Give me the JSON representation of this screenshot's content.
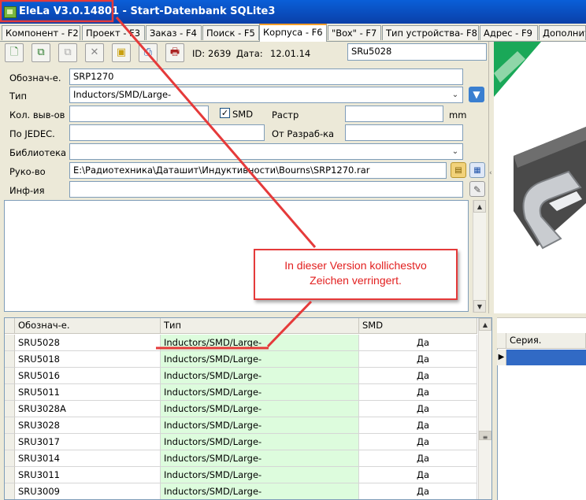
{
  "window": {
    "app_name": "EleLa V3.0.14801",
    "title_rest": " - Start-Datenbank SQLite3"
  },
  "tabs": [
    {
      "label": "Компонент - F2"
    },
    {
      "label": "Проект - F3"
    },
    {
      "label": "Заказ - F4"
    },
    {
      "label": "Поиск - F5"
    },
    {
      "label": "Корпуса - F6",
      "active": true
    },
    {
      "label": "\"Box\" - F7"
    },
    {
      "label": "Тип устройства- F8"
    },
    {
      "label": "Адрес - F9"
    },
    {
      "label": "Дополнит"
    }
  ],
  "toolbar": {
    "buttons": [
      {
        "name": "new-record-icon",
        "glyph": "🗋"
      },
      {
        "name": "copy-record-icon",
        "glyph": "⧉"
      },
      {
        "name": "copy-disabled-icon",
        "glyph": "⧉"
      },
      {
        "name": "delete-icon",
        "glyph": "✕"
      },
      {
        "name": "save-icon",
        "glyph": "▣"
      },
      {
        "name": "print-icon",
        "glyph": "⎙"
      },
      {
        "name": "print-preview-icon",
        "glyph": "🖶"
      }
    ],
    "id_label": "ID:",
    "id_value": "2639",
    "date_label": "Дата:",
    "date_value": "12.01.14",
    "name_value": "SRu5028"
  },
  "form": {
    "designation_label": "Обознач-е.",
    "designation_value": "SRP1270",
    "type_label": "Тип",
    "type_value": "Inductors/SMD/Large-",
    "pins_label": "Кол. выв-ов",
    "pins_value": "",
    "smd_label": "SMD",
    "smd_checked": true,
    "pitch_label": "Растр",
    "pitch_value": "",
    "pitch_unit": "mm",
    "jedec_label": "По JEDEC.",
    "jedec_value": "",
    "developer_label": "От Разраб-ка",
    "developer_value": "",
    "library_label": "Библиотека",
    "library_value": "",
    "manual_label": "Руко-во",
    "manual_value": "E:\\Радиотехника\\Даташит\\Индуктивности\\Bourns\\SRP1270.rar",
    "info_label": "Инф-ия",
    "info_value": ""
  },
  "grid": {
    "columns": [
      "Обознач-е.",
      "Тип",
      "SMD"
    ],
    "rows": [
      {
        "designation": "SRU5028",
        "type": "Inductors/SMD/Large-",
        "smd": "Да"
      },
      {
        "designation": "SRU5018",
        "type": "Inductors/SMD/Large-",
        "smd": "Да"
      },
      {
        "designation": "SRU5016",
        "type": "Inductors/SMD/Large-",
        "smd": "Да"
      },
      {
        "designation": "SRU5011",
        "type": "Inductors/SMD/Large-",
        "smd": "Да"
      },
      {
        "designation": "SRU3028A",
        "type": "Inductors/SMD/Large-",
        "smd": "Да"
      },
      {
        "designation": "SRU3028",
        "type": "Inductors/SMD/Large-",
        "smd": "Да"
      },
      {
        "designation": "SRU3017",
        "type": "Inductors/SMD/Large-",
        "smd": "Да"
      },
      {
        "designation": "SRU3014",
        "type": "Inductors/SMD/Large-",
        "smd": "Да"
      },
      {
        "designation": "SRU3011",
        "type": "Inductors/SMD/Large-",
        "smd": "Да"
      },
      {
        "designation": "SRU3009",
        "type": "Inductors/SMD/Large-",
        "smd": "Да"
      }
    ]
  },
  "side_grid": {
    "column": "Серия."
  },
  "callout": {
    "line1": "In dieser Version kollichestvo",
    "line2": "Zeichen verringert."
  },
  "colors": {
    "callout_red": "#E53A3A",
    "title_blue": "#0A5FD8",
    "active_tab": "#FF9F2A",
    "type_cell": "#DDFCDD",
    "selected_row": "#316AC5"
  }
}
